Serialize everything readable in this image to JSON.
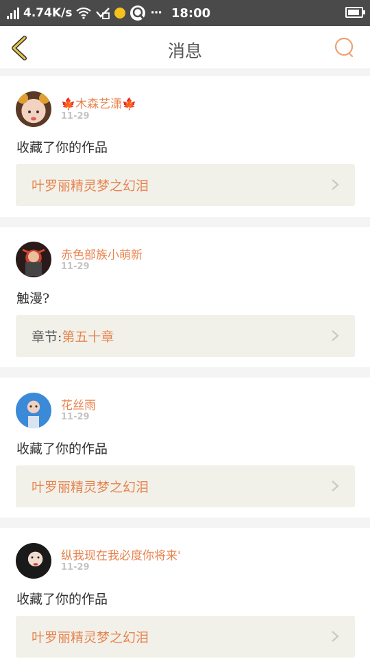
{
  "status_bar": {
    "speed": "4.74K/s",
    "time": "18:00",
    "icons": [
      "signal-icon",
      "wifi-icon",
      "vpn-icon",
      "notification-dot-icon",
      "cloud-icon",
      "more-dots-icon",
      "battery-icon"
    ],
    "more": "···"
  },
  "header": {
    "title": "消息",
    "back_icon": "chevron-left-icon",
    "search_icon": "search-icon"
  },
  "messages": [
    {
      "username": "🍁木森艺潇🍁",
      "date": "11-29",
      "text": "收藏了你的作品",
      "ref_prefix": "",
      "ref_text": "叶罗丽精灵梦之幻泪"
    },
    {
      "username": "赤色部族小萌新",
      "date": "11-29",
      "text": "触漫?",
      "ref_prefix": "章节:",
      "ref_text": "第五十章"
    },
    {
      "username": "花丝雨",
      "date": "11-29",
      "text": "收藏了你的作品",
      "ref_prefix": "",
      "ref_text": "叶罗丽精灵梦之幻泪"
    },
    {
      "username": "纵我现在我必度你将来'",
      "date": "11-29",
      "text": "收藏了你的作品",
      "ref_prefix": "",
      "ref_text": "叶罗丽精灵梦之幻泪"
    }
  ],
  "colors": {
    "accent": "#e8834e",
    "back_arrow": "#e9c24a",
    "status_bar": "#4a4a4a",
    "ref_box": "#f1f1ea"
  }
}
